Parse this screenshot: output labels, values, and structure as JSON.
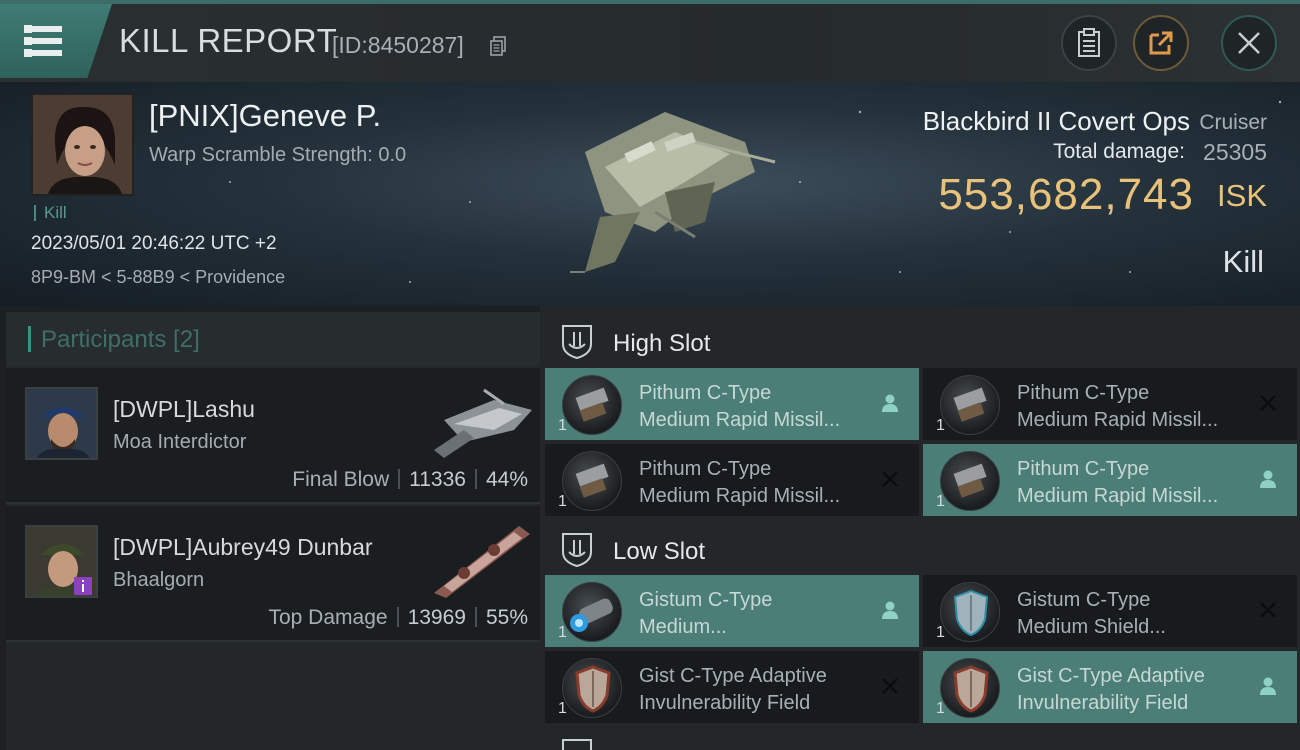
{
  "header": {
    "title": "KILL REPORT",
    "report_id": "[ID:8450287]",
    "icons": {
      "menu": "menu-icon",
      "copy": "copy-icon",
      "clipboard": "clipboard-icon",
      "share": "share-icon",
      "close": "close-icon"
    }
  },
  "victim": {
    "name": "[PNIX]Geneve P.",
    "warp_scramble": "Warp Scramble Strength: 0.0",
    "tag": "Kill",
    "datetime": "2023/05/01 20:46:22 UTC +2",
    "location": "8P9-BM < 5-88B9 < Providence",
    "ship_name": "Blackbird II Covert Ops",
    "ship_class": "Cruiser",
    "total_damage_label": "Total damage:",
    "total_damage": "25305",
    "isk_value": "553,682,743",
    "isk_unit": "ISK",
    "result": "Kill"
  },
  "participants": {
    "title": "Participants [2]",
    "list": [
      {
        "name": "[DWPL]Lashu",
        "ship": "Moa Interdictor",
        "role": "Final Blow",
        "damage": "11336",
        "percent": "44%"
      },
      {
        "name": "[DWPL]Aubrey49 Dunbar",
        "ship": "Bhaalgorn",
        "role": "Top Damage",
        "damage": "13969",
        "percent": "55%"
      }
    ]
  },
  "fitting": {
    "high_slot": {
      "title": "High Slot",
      "modules": [
        {
          "line1": "Pithum C-Type",
          "line2": "Medium Rapid Missil...",
          "qty": "1",
          "status": "pilot-icon",
          "active": true
        },
        {
          "line1": "Pithum C-Type",
          "line2": "Medium Rapid Missil...",
          "qty": "1",
          "status": "destroyed-icon",
          "active": false
        },
        {
          "line1": "Pithum C-Type",
          "line2": "Medium Rapid Missil...",
          "qty": "1",
          "status": "destroyed-icon",
          "active": false
        },
        {
          "line1": "Pithum C-Type",
          "line2": "Medium Rapid Missil...",
          "qty": "1",
          "status": "pilot-icon",
          "active": true
        }
      ]
    },
    "low_slot": {
      "title": "Low Slot",
      "modules": [
        {
          "line1": "Gistum C-Type",
          "line2": "Medium...",
          "qty": "1",
          "status": "pilot-icon",
          "active": true
        },
        {
          "line1": "Gistum C-Type",
          "line2": "Medium Shield...",
          "qty": "1",
          "status": "destroyed-icon",
          "active": false
        },
        {
          "line1": "Gist C-Type Adaptive",
          "line2": "Invulnerability Field",
          "qty": "1",
          "status": "destroyed-icon",
          "active": false
        },
        {
          "line1": "Gist C-Type Adaptive",
          "line2": "Invulnerability Field",
          "qty": "1",
          "status": "pilot-icon",
          "active": true
        }
      ]
    }
  },
  "colors": {
    "accent": "#4a7e77",
    "isk": "#e8c27a",
    "header_bar": "#3d6d68"
  }
}
